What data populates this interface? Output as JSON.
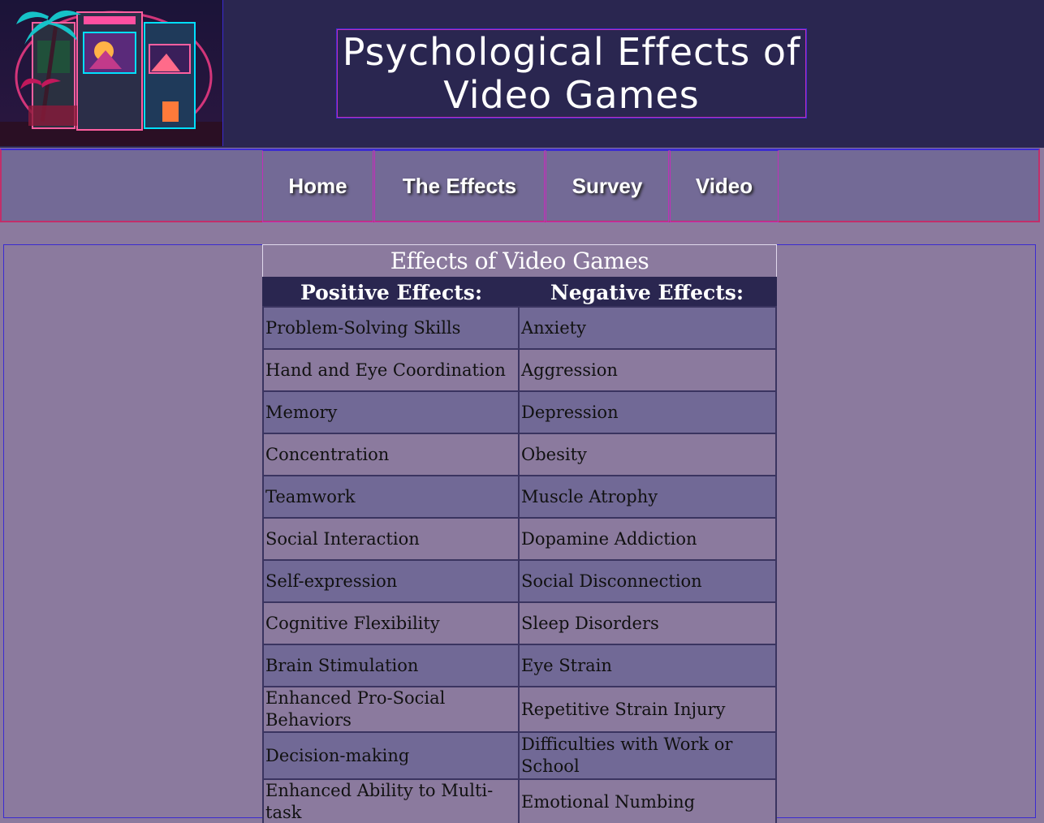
{
  "header": {
    "title": "Psychological Effects of Video Games",
    "logo_icon": "arcade-cabinets-logo"
  },
  "nav": {
    "items": [
      {
        "label": "Home"
      },
      {
        "label": "The Effects"
      },
      {
        "label": "Survey"
      },
      {
        "label": "Video"
      }
    ]
  },
  "table": {
    "caption": "Effects of Video Games",
    "headers": [
      "Positive Effects:",
      "Negative Effects:"
    ],
    "rows": [
      [
        "Problem-Solving Skills",
        "Anxiety"
      ],
      [
        "Hand and Eye Coordination",
        "Aggression"
      ],
      [
        "Memory",
        "Depression"
      ],
      [
        "Concentration",
        "Obesity"
      ],
      [
        "Teamwork",
        "Muscle Atrophy"
      ],
      [
        "Social Interaction",
        "Dopamine Addiction"
      ],
      [
        "Self-expression",
        "Social Disconnection"
      ],
      [
        "Cognitive Flexibility",
        "Sleep Disorders"
      ],
      [
        "Brain Stimulation",
        "Eye Strain"
      ],
      [
        "Enhanced Pro-Social Behaviors",
        "Repetitive Strain Injury"
      ],
      [
        "Decision-making",
        "Difficulties with Work or School"
      ],
      [
        "Enhanced Ability to Multi-task",
        "Emotional Numbing"
      ]
    ]
  },
  "colors": {
    "background": "#8b7a9e",
    "header": "#2a2650",
    "nav": "#736a96",
    "row_alt": "#716996",
    "accent_pink": "#c12fb8",
    "accent_blue": "#3b2bd0"
  }
}
